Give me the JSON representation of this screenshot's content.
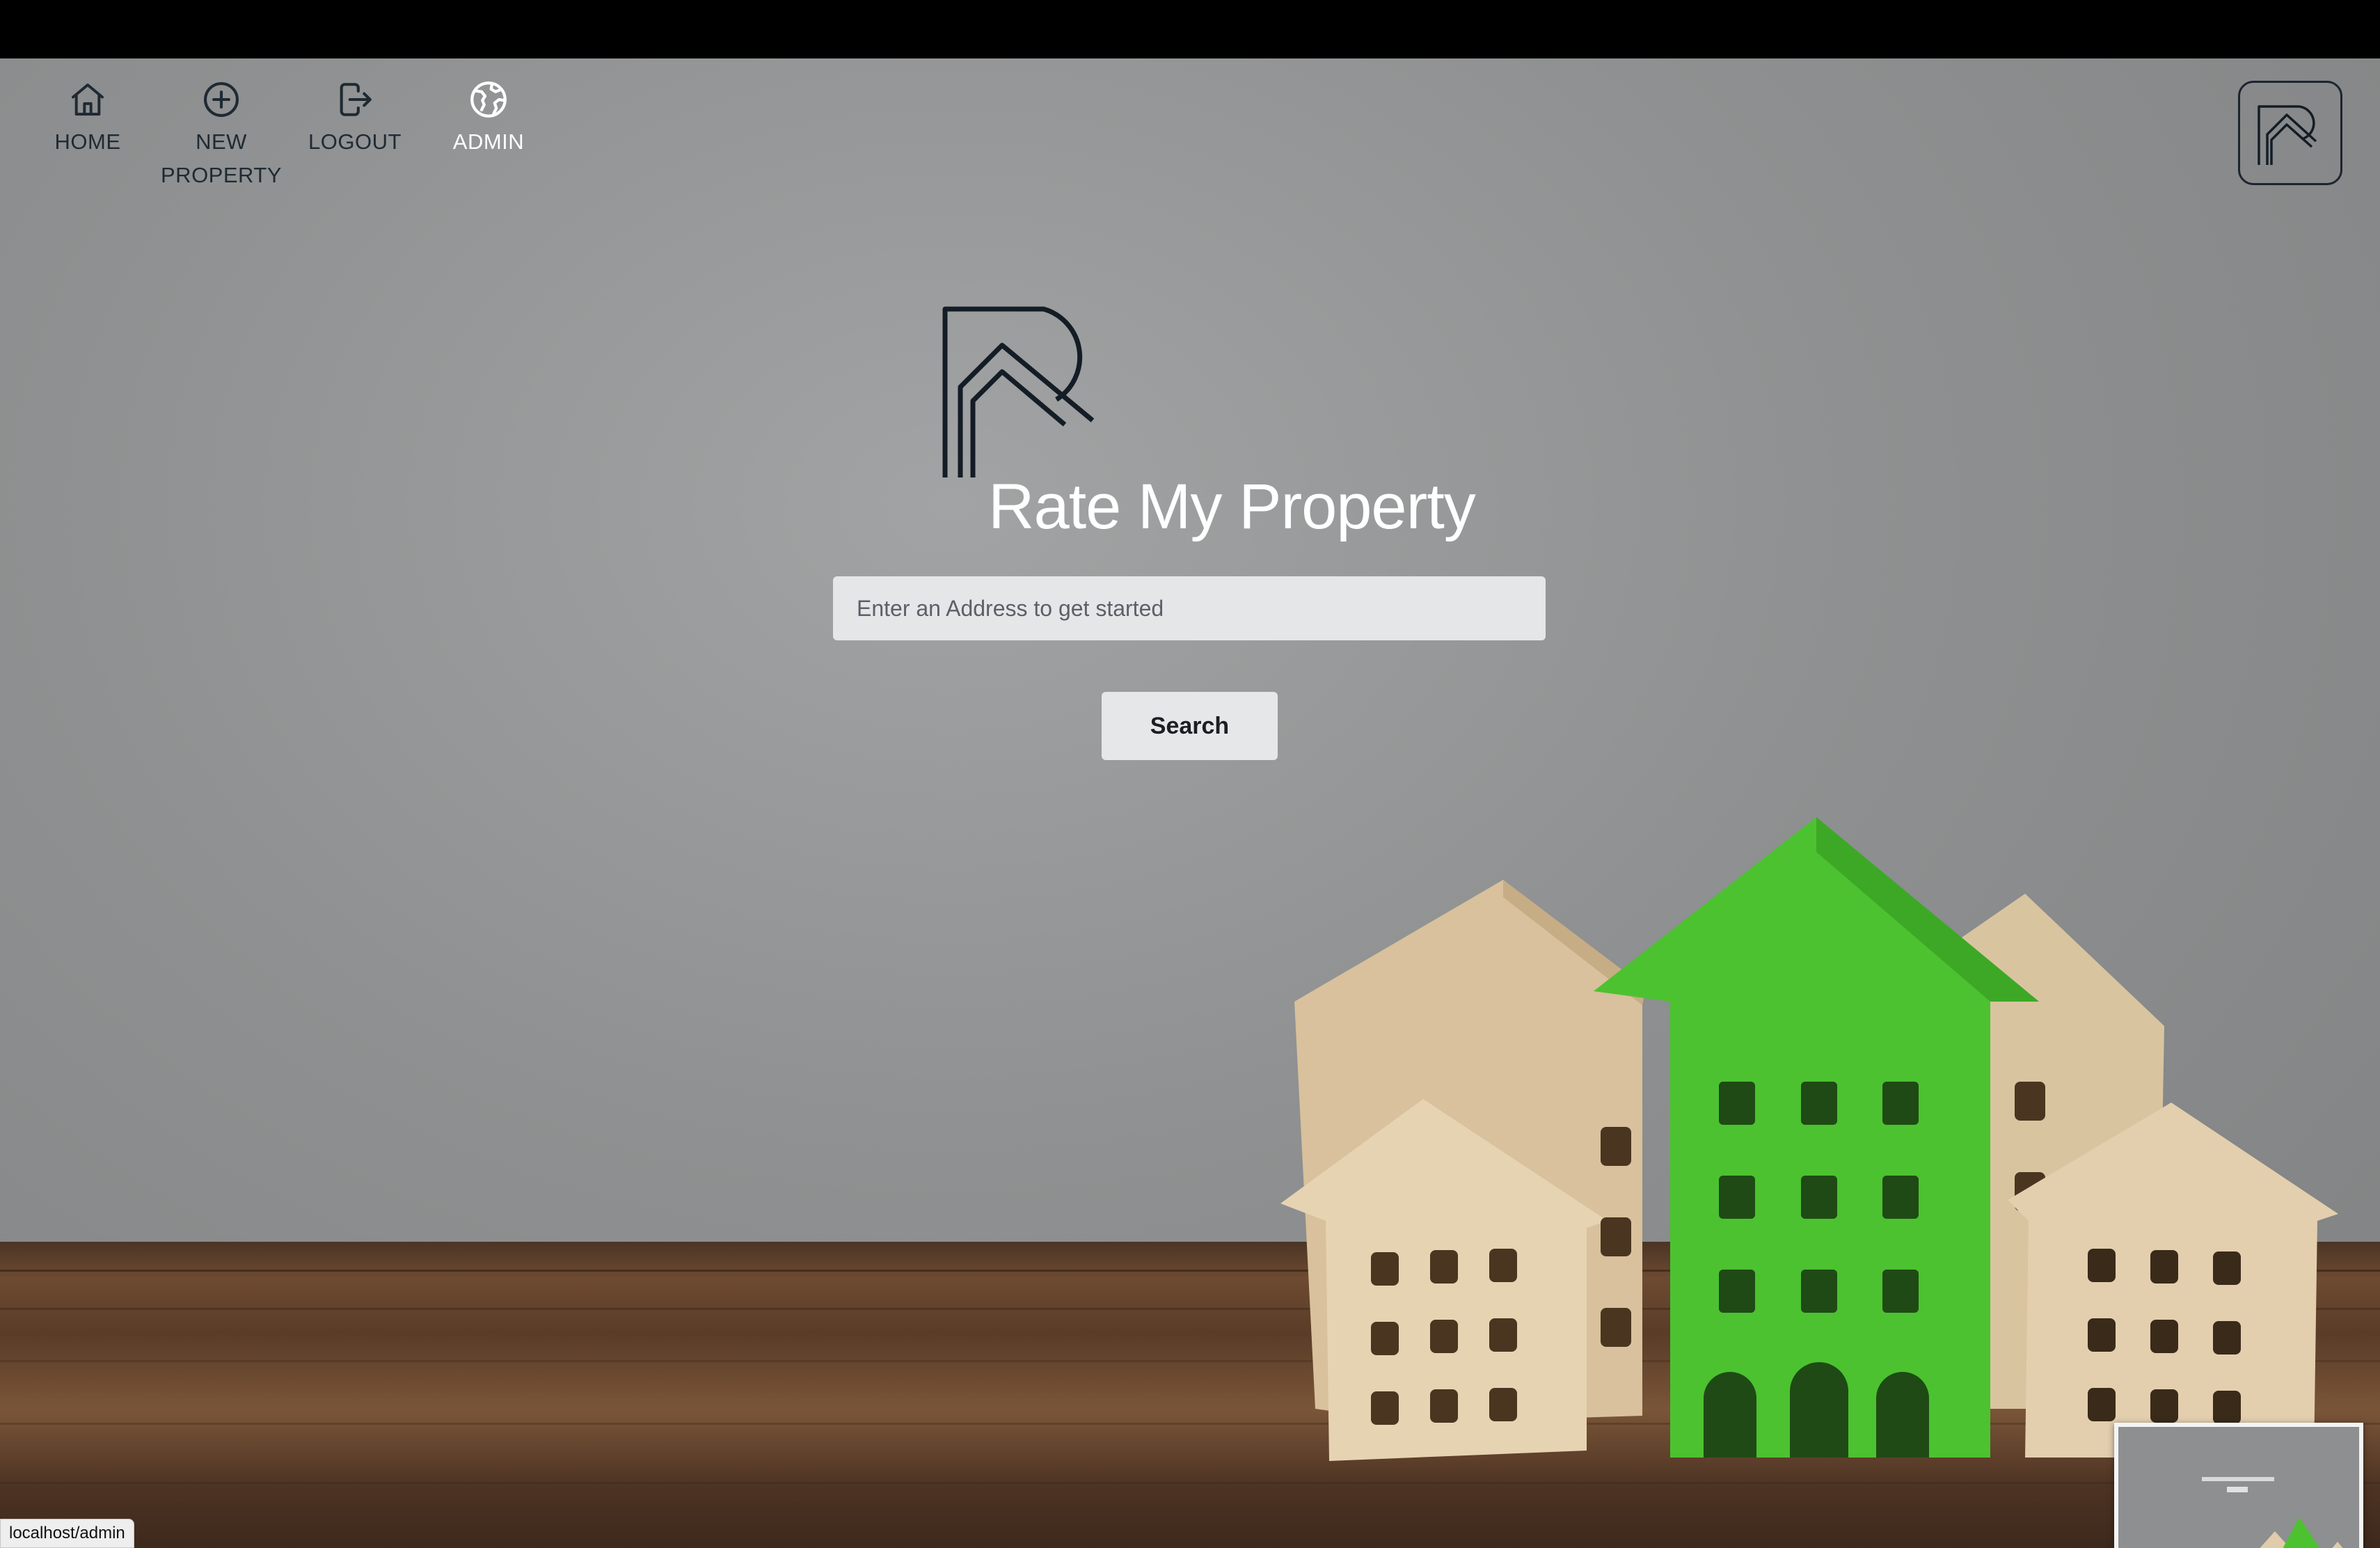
{
  "nav": {
    "items": [
      {
        "label": "HOME",
        "icon": "home-icon"
      },
      {
        "label": "NEW PROPERTY",
        "icon": "plus-circle-icon"
      },
      {
        "label": "LOGOUT",
        "icon": "logout-icon"
      },
      {
        "label": "ADMIN",
        "icon": "globe-icon",
        "active": true
      }
    ]
  },
  "brand": {
    "name": "Rate My Property",
    "logo_icon": "rmp-logo-icon"
  },
  "search": {
    "placeholder": "Enter an Address to get started",
    "value": "",
    "button_label": "Search"
  },
  "status_bar": {
    "url": "localhost/admin"
  },
  "colors": {
    "nav_text": "#1f2a33",
    "nav_active_text": "#ffffff",
    "brand_text": "#ffffff",
    "logo_stroke": "#141d26",
    "input_bg": "#e5e6e8",
    "button_bg": "#e6e7e9",
    "house_green": "#4cc230",
    "house_wood": "#e2cfae"
  }
}
